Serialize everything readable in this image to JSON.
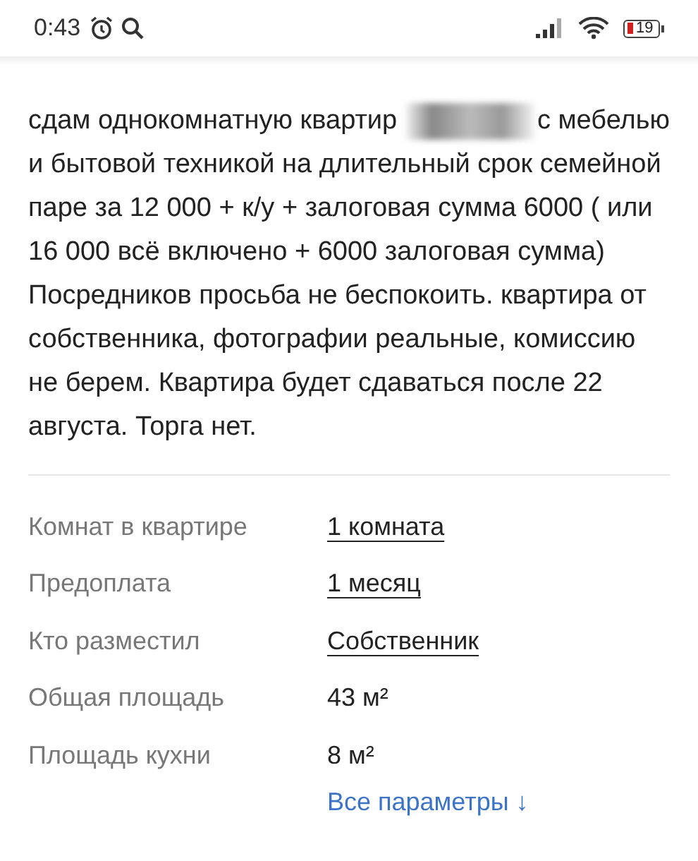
{
  "status_bar": {
    "time": "0:43",
    "battery": "19"
  },
  "description": {
    "lead": "сдам однокомнатную квартир",
    "after_blur": "с мебелью",
    "body": "и бытовой техникой на длительный срок семейной паре за 12 000 + к/у + залоговая сумма 6000 ( или 16 000 всё включено + 6000 залоговая сумма) Посредников просьба не беспокоить. квартира от собственника, фотографии реальные, комиссию не берем. Квартира будет сдаваться после 22 августа. Торга нет."
  },
  "params": [
    {
      "label": "Комнат в квартире",
      "value": "1 комната",
      "kind": "link"
    },
    {
      "label": "Предоплата",
      "value": "1 месяц",
      "kind": "link"
    },
    {
      "label": "Кто разместил",
      "value": "Собственник",
      "kind": "link"
    },
    {
      "label": "Общая площадь",
      "value": "43 м²",
      "kind": "plain"
    },
    {
      "label": "Площадь кухни",
      "value": "8 м²",
      "kind": "plain"
    }
  ],
  "all_params_link": "Все параметры ↓"
}
